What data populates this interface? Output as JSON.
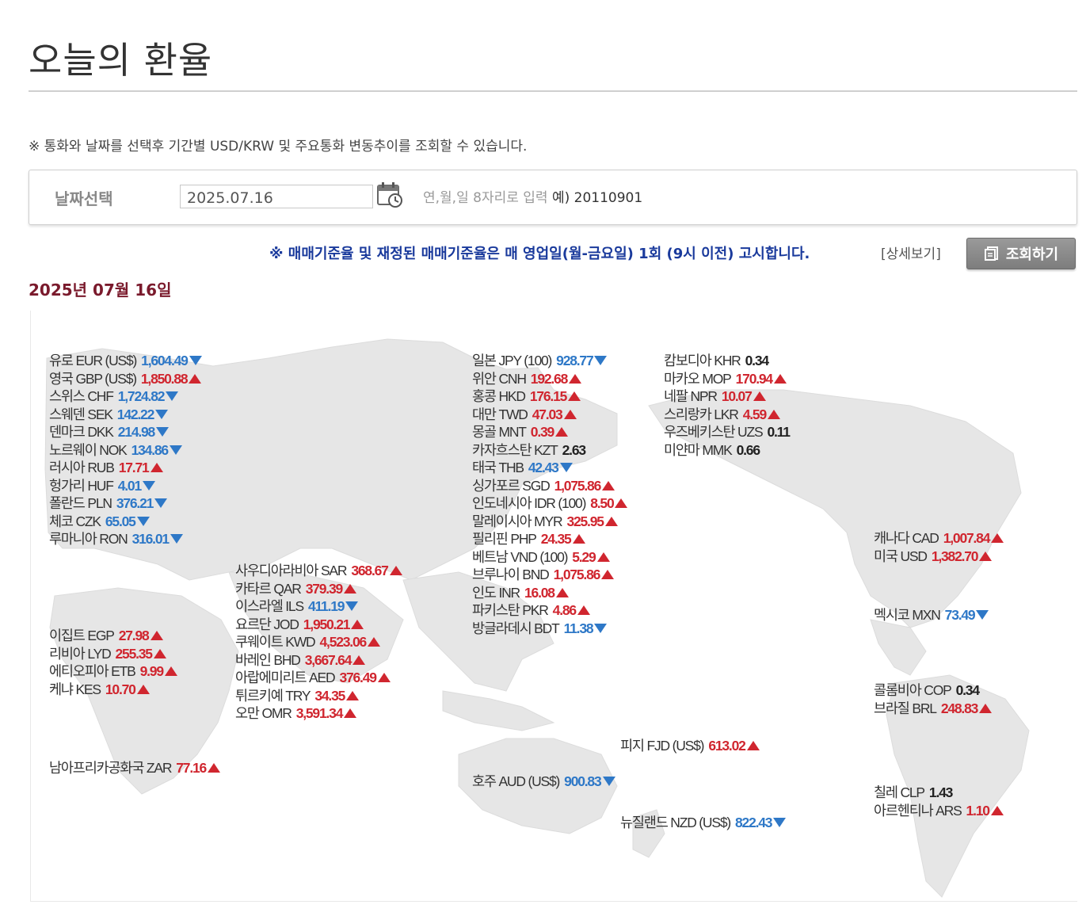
{
  "title": "오늘의 환율",
  "notice": {
    "mark": "※",
    "text": " 통화와 날짜를 선택후 기간별 USD/KRW 및 주요통화 변동추이를 조회할 수 있습니다."
  },
  "date_select": {
    "label": "날짜선택",
    "value": "2025.07.16",
    "hint": "연,월,일 8자리로 입력 ",
    "hint_example": "예) 20110901"
  },
  "policy_text": "※ 매매기준율 및 재정된 매매기준율은 매 영업일(월-금요일) 1회 (9시 이전) 고시합니다.",
  "detail_link": "[상세보기]",
  "query_button": "조회하기",
  "date_heading": {
    "year": "2025",
    "year_unit": "년 ",
    "month": "07",
    "month_unit": "월 ",
    "day": "16",
    "day_unit": "일"
  },
  "colors": {
    "up": "#d0262f",
    "down": "#2e78c7",
    "flat": "#222222",
    "policy": "#1a3a9c",
    "date_heading": "#7a1a2c",
    "map_land": "#e6e6e6"
  },
  "groups": [
    {
      "id": "europe",
      "rows": [
        {
          "name": "유로 EUR (US$)",
          "value": "1,604.49",
          "trend": "down"
        },
        {
          "name": "영국 GBP (US$)",
          "value": "1,850.88",
          "trend": "up"
        },
        {
          "name": "스위스 CHF",
          "value": "1,724.82",
          "trend": "down"
        },
        {
          "name": "스웨덴 SEK",
          "value": "142.22",
          "trend": "down"
        },
        {
          "name": "덴마크 DKK",
          "value": "214.98",
          "trend": "down"
        },
        {
          "name": "노르웨이 NOK",
          "value": "134.86",
          "trend": "down"
        },
        {
          "name": "러시아 RUB",
          "value": "17.71",
          "trend": "up"
        },
        {
          "name": "헝가리 HUF",
          "value": "4.01",
          "trend": "down"
        },
        {
          "name": "폴란드 PLN",
          "value": "376.21",
          "trend": "down"
        },
        {
          "name": "체코 CZK",
          "value": "65.05",
          "trend": "down"
        },
        {
          "name": "루마니아 RON",
          "value": "316.01",
          "trend": "down"
        }
      ]
    },
    {
      "id": "middle-east",
      "rows": [
        {
          "name": "사우디아라비아 SAR",
          "value": "368.67",
          "trend": "up"
        },
        {
          "name": "카타르 QAR",
          "value": "379.39",
          "trend": "up"
        },
        {
          "name": "이스라엘 ILS",
          "value": "411.19",
          "trend": "down"
        },
        {
          "name": "요르단 JOD",
          "value": "1,950.21",
          "trend": "up"
        },
        {
          "name": "쿠웨이트 KWD",
          "value": "4,523.06",
          "trend": "up"
        },
        {
          "name": "바레인 BHD",
          "value": "3,667.64",
          "trend": "up"
        },
        {
          "name": "아랍에미리트 AED",
          "value": "376.49",
          "trend": "up"
        },
        {
          "name": "튀르키예 TRY",
          "value": "34.35",
          "trend": "up"
        },
        {
          "name": "오만 OMR",
          "value": "3,591.34",
          "trend": "up"
        }
      ]
    },
    {
      "id": "africa",
      "rows": [
        {
          "name": "이집트 EGP",
          "value": "27.98",
          "trend": "up"
        },
        {
          "name": "리비아 LYD",
          "value": "255.35",
          "trend": "up"
        },
        {
          "name": "에티오피아 ETB",
          "value": "9.99",
          "trend": "up"
        },
        {
          "name": "케냐 KES",
          "value": "10.70",
          "trend": "up"
        }
      ]
    },
    {
      "id": "south-africa",
      "rows": [
        {
          "name": "남아프리카공화국 ZAR",
          "value": "77.16",
          "trend": "up"
        }
      ]
    },
    {
      "id": "asia",
      "rows": [
        {
          "name": "일본 JPY (100)",
          "value": "928.77",
          "trend": "down"
        },
        {
          "name": "위안 CNH",
          "value": "192.68",
          "trend": "up"
        },
        {
          "name": "홍콩 HKD",
          "value": "176.15",
          "trend": "up"
        },
        {
          "name": "대만 TWD",
          "value": "47.03",
          "trend": "up"
        },
        {
          "name": "몽골 MNT",
          "value": "0.39",
          "trend": "up"
        },
        {
          "name": "카자흐스탄 KZT",
          "value": "2.63",
          "trend": "flat"
        },
        {
          "name": "태국 THB",
          "value": "42.43",
          "trend": "down"
        },
        {
          "name": "싱가포르 SGD",
          "value": "1,075.86",
          "trend": "up"
        },
        {
          "name": "인도네시아 IDR (100)",
          "value": "8.50",
          "trend": "up"
        },
        {
          "name": "말레이시아 MYR",
          "value": "325.95",
          "trend": "up"
        },
        {
          "name": "필리핀 PHP",
          "value": "24.35",
          "trend": "up"
        },
        {
          "name": "베트남 VND (100)",
          "value": "5.29",
          "trend": "up"
        },
        {
          "name": "브루나이 BND",
          "value": "1,075.86",
          "trend": "up"
        },
        {
          "name": "인도 INR",
          "value": "16.08",
          "trend": "up"
        },
        {
          "name": "파키스탄 PKR",
          "value": "4.86",
          "trend": "up"
        },
        {
          "name": "방글라데시 BDT",
          "value": "11.38",
          "trend": "down"
        }
      ]
    },
    {
      "id": "asia-2",
      "rows": [
        {
          "name": "캄보디아 KHR",
          "value": "0.34",
          "trend": "flat"
        },
        {
          "name": "마카오 MOP",
          "value": "170.94",
          "trend": "up"
        },
        {
          "name": "네팔 NPR",
          "value": "10.07",
          "trend": "up"
        },
        {
          "name": "스리랑카 LKR",
          "value": "4.59",
          "trend": "up"
        },
        {
          "name": "우즈베키스탄 UZS",
          "value": "0.11",
          "trend": "flat"
        },
        {
          "name": "미얀마 MMK",
          "value": "0.66",
          "trend": "flat"
        }
      ]
    },
    {
      "id": "north-america",
      "rows": [
        {
          "name": "캐나다 CAD",
          "value": "1,007.84",
          "trend": "up"
        },
        {
          "name": "미국 USD",
          "value": "1,382.70",
          "trend": "up"
        }
      ]
    },
    {
      "id": "mexico",
      "rows": [
        {
          "name": "멕시코 MXN",
          "value": "73.49",
          "trend": "down"
        }
      ]
    },
    {
      "id": "south-america",
      "rows": [
        {
          "name": "콜롬비아 COP",
          "value": "0.34",
          "trend": "flat"
        },
        {
          "name": "브라질 BRL",
          "value": "248.83",
          "trend": "up"
        }
      ]
    },
    {
      "id": "south-america-2",
      "rows": [
        {
          "name": "칠레 CLP",
          "value": "1.43",
          "trend": "flat"
        },
        {
          "name": "아르헨티나 ARS",
          "value": "1.10",
          "trend": "up"
        }
      ]
    },
    {
      "id": "fiji",
      "rows": [
        {
          "name": "피지 FJD (US$)",
          "value": "613.02",
          "trend": "up"
        }
      ]
    },
    {
      "id": "australia",
      "rows": [
        {
          "name": "호주 AUD (US$)",
          "value": "900.83",
          "trend": "down"
        }
      ]
    },
    {
      "id": "new-zealand",
      "rows": [
        {
          "name": "뉴질랜드 NZD (US$)",
          "value": "822.43",
          "trend": "down"
        }
      ]
    }
  ]
}
